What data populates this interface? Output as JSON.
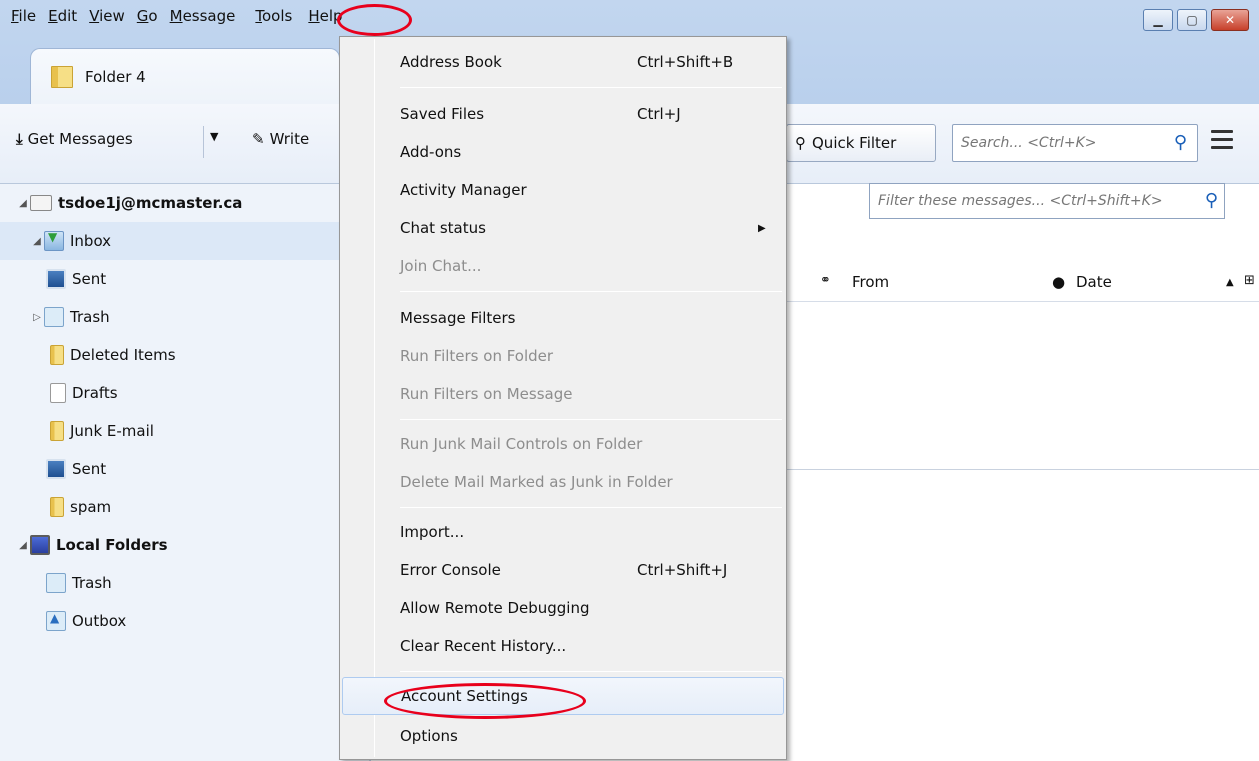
{
  "menubar": {
    "items": [
      {
        "pre": "",
        "key": "F",
        "post": "ile"
      },
      {
        "pre": "",
        "key": "E",
        "post": "dit"
      },
      {
        "pre": "",
        "key": "V",
        "post": "iew"
      },
      {
        "pre": "",
        "key": "G",
        "post": "o"
      },
      {
        "pre": "",
        "key": "M",
        "post": "essage"
      },
      {
        "pre": "",
        "key": "T",
        "post": "ools"
      },
      {
        "pre": "",
        "key": "H",
        "post": "elp"
      }
    ]
  },
  "tab": {
    "label": "Folder 4"
  },
  "toolbar": {
    "get_messages": "Get Messages",
    "write": "Write",
    "quick_filter": "Quick Filter",
    "search_placeholder": "Search... <Ctrl+K>"
  },
  "folders": {
    "account": "tsdoe1j@mcmaster.ca",
    "items": [
      "Inbox",
      "Sent",
      "Trash",
      "Deleted Items",
      "Drafts",
      "Junk E-mail",
      "Sent",
      "spam"
    ],
    "local": "Local Folders",
    "local_items": [
      "Trash",
      "Outbox"
    ]
  },
  "messages": {
    "filter_placeholder": "Filter these messages... <Ctrl+Shift+K>",
    "col_from": "From",
    "col_date": "Date"
  },
  "tools_menu": {
    "items": [
      {
        "label": "Address Book",
        "shortcut": "Ctrl+Shift+B",
        "disabled": false
      },
      {
        "label": "Saved Files",
        "shortcut": "Ctrl+J",
        "disabled": false
      },
      {
        "label": "Add-ons",
        "shortcut": "",
        "disabled": false
      },
      {
        "label": "Activity Manager",
        "shortcut": "",
        "disabled": false
      },
      {
        "label": "Chat status",
        "shortcut": "",
        "disabled": false,
        "submenu": true
      },
      {
        "label": "Join Chat...",
        "shortcut": "",
        "disabled": true
      },
      {
        "label": "Message Filters",
        "shortcut": "",
        "disabled": false
      },
      {
        "label": "Run Filters on Folder",
        "shortcut": "",
        "disabled": true
      },
      {
        "label": "Run Filters on Message",
        "shortcut": "",
        "disabled": true
      },
      {
        "label": "Run Junk Mail Controls on Folder",
        "shortcut": "",
        "disabled": true
      },
      {
        "label": "Delete Mail Marked as Junk in Folder",
        "shortcut": "",
        "disabled": true
      },
      {
        "label": "Import...",
        "shortcut": "",
        "disabled": false
      },
      {
        "label": "Error Console",
        "shortcut": "Ctrl+Shift+J",
        "disabled": false
      },
      {
        "label": "Allow Remote Debugging",
        "shortcut": "",
        "disabled": false
      },
      {
        "label": "Clear Recent History...",
        "shortcut": "",
        "disabled": false
      },
      {
        "label": "Account Settings",
        "shortcut": "",
        "disabled": false,
        "highlighted": true
      },
      {
        "label": "Options",
        "shortcut": "",
        "disabled": false
      }
    ]
  },
  "colors": {
    "highlight_circle": "#e8001c",
    "link_blue": "#1a5fb8"
  }
}
